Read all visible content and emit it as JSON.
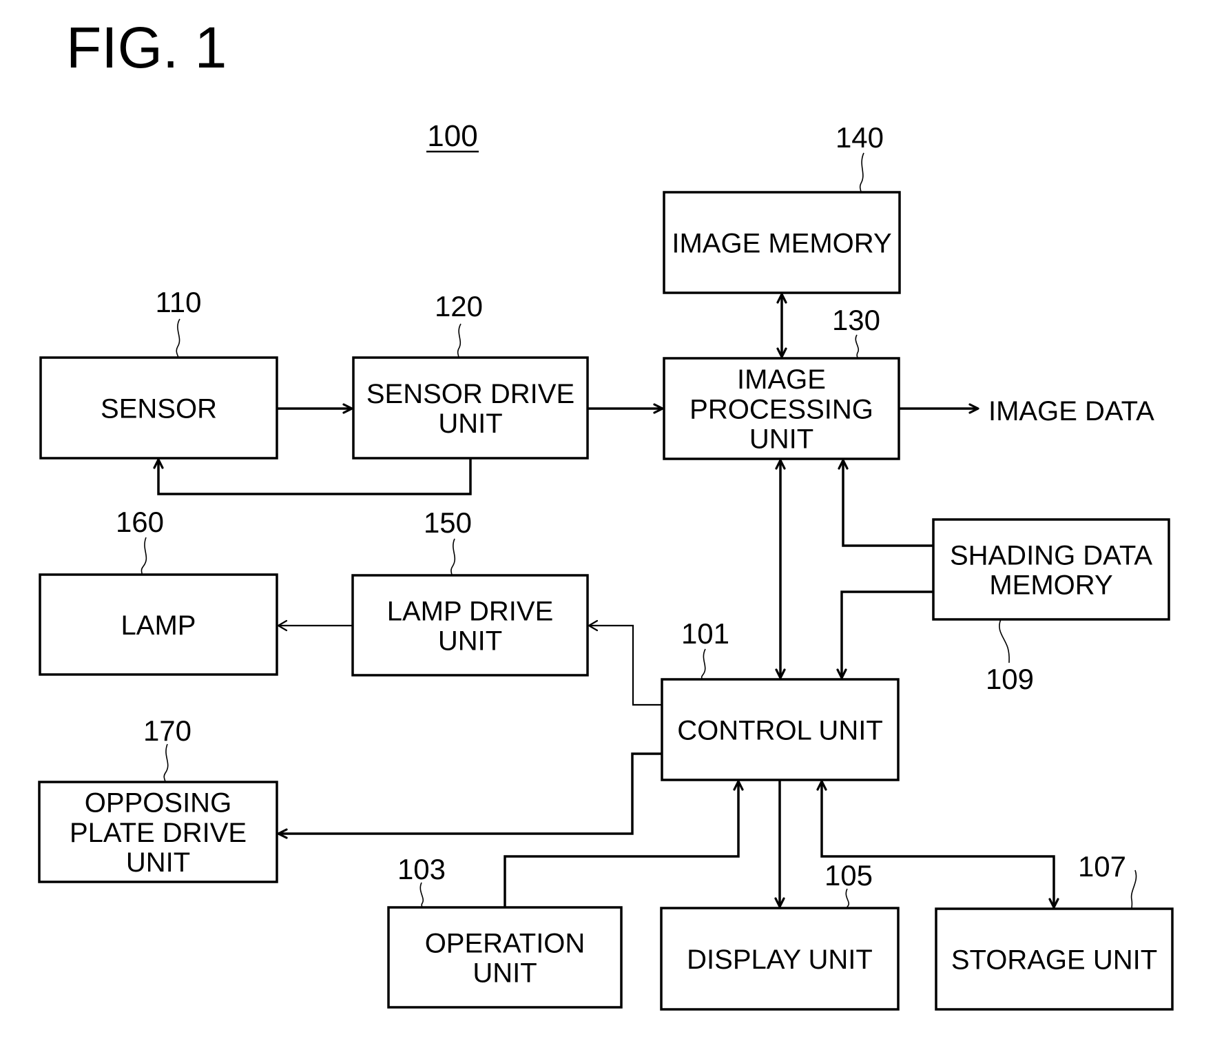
{
  "figure": {
    "title": "FIG. 1",
    "system_ref": "100"
  },
  "blocks": {
    "sensor": {
      "ref": "110",
      "lines": [
        "SENSOR"
      ]
    },
    "sensor_drive": {
      "ref": "120",
      "lines": [
        "SENSOR DRIVE",
        "UNIT"
      ]
    },
    "image_processing": {
      "ref": "130",
      "lines": [
        "IMAGE",
        "PROCESSING",
        "UNIT"
      ]
    },
    "image_memory": {
      "ref": "140",
      "lines": [
        "IMAGE MEMORY"
      ]
    },
    "lamp": {
      "ref": "160",
      "lines": [
        "LAMP"
      ]
    },
    "lamp_drive": {
      "ref": "150",
      "lines": [
        "LAMP DRIVE",
        "UNIT"
      ]
    },
    "shading_memory": {
      "ref": "109",
      "lines": [
        "SHADING DATA",
        "MEMORY"
      ]
    },
    "control": {
      "ref": "101",
      "lines": [
        "CONTROL UNIT"
      ]
    },
    "opposing_plate_drive": {
      "ref": "170",
      "lines": [
        "OPPOSING",
        "PLATE DRIVE",
        "UNIT"
      ]
    },
    "operation": {
      "ref": "103",
      "lines": [
        "OPERATION",
        "UNIT"
      ]
    },
    "display": {
      "ref": "105",
      "lines": [
        "DISPLAY UNIT"
      ]
    },
    "storage": {
      "ref": "107",
      "lines": [
        "STORAGE UNIT"
      ]
    }
  },
  "outputs": {
    "image_data": "IMAGE DATA"
  },
  "connections": [
    {
      "from": "sensor",
      "to": "sensor_drive",
      "direction": "one-way"
    },
    {
      "from": "sensor_drive",
      "to": "sensor",
      "direction": "one-way"
    },
    {
      "from": "sensor_drive",
      "to": "image_processing",
      "direction": "one-way"
    },
    {
      "from": "image_processing",
      "to": "image_memory",
      "direction": "two-way"
    },
    {
      "from": "image_processing",
      "to": "image_data",
      "direction": "one-way"
    },
    {
      "from": "image_processing",
      "to": "control",
      "direction": "two-way"
    },
    {
      "from": "shading_memory",
      "to": "image_processing",
      "direction": "one-way"
    },
    {
      "from": "shading_memory",
      "to": "control",
      "direction": "one-way"
    },
    {
      "from": "lamp_drive",
      "to": "lamp",
      "direction": "one-way"
    },
    {
      "from": "control",
      "to": "lamp_drive",
      "direction": "one-way"
    },
    {
      "from": "control",
      "to": "opposing_plate_drive",
      "direction": "one-way"
    },
    {
      "from": "operation",
      "to": "control",
      "direction": "one-way"
    },
    {
      "from": "control",
      "to": "display",
      "direction": "one-way"
    },
    {
      "from": "control",
      "to": "storage",
      "direction": "two-way"
    }
  ]
}
